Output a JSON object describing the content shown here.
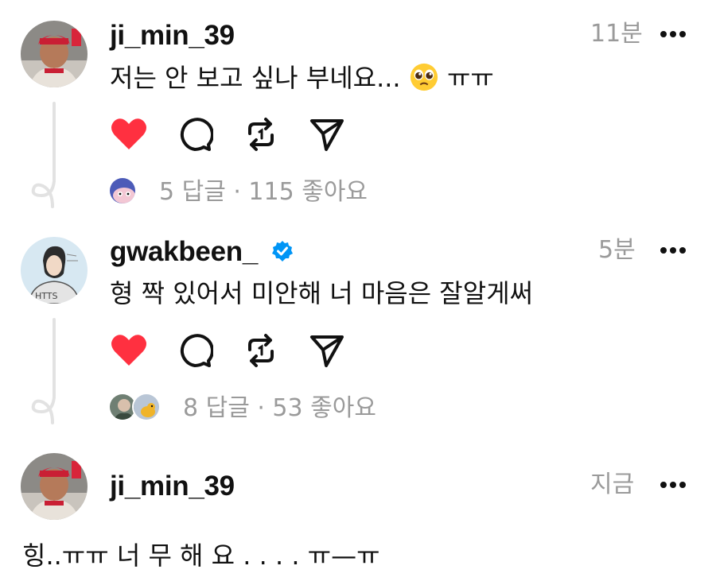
{
  "posts": [
    {
      "username": "ji_min_39",
      "time": "11분",
      "text": "저는 안 보고 싶나 부네요...",
      "text_suffix": "ㅠㅠ",
      "emoji": "pleading-face",
      "verified": false,
      "stats": "5 답글 · 115 좋아요",
      "liked": true
    },
    {
      "username": "gwakbeen_",
      "time": "5분",
      "text": "형 짝 있어서 미안해 너 마음은 잘알게써",
      "verified": true,
      "avatar_text": "HTTS",
      "stats": "8 답글 · 53 좋아요",
      "liked": true
    },
    {
      "username": "ji_min_39",
      "time": "지금",
      "text": "힝..ㅠㅠ 너 무 해 요 . . . .  ㅠ—ㅠ",
      "verified": false
    }
  ],
  "colors": {
    "like": "#ff3040",
    "meta": "#9a9a9a",
    "verified": "#0095f6"
  }
}
